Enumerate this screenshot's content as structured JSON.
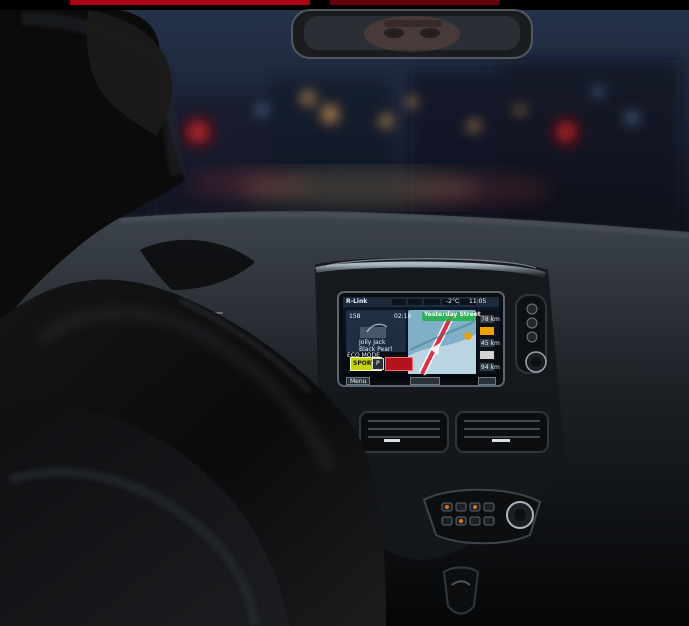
{
  "infotainment": {
    "brand": "R-Link",
    "clock": "11:05",
    "temperature": "-2°C",
    "media": {
      "song_line1": "Jolly Jack",
      "song_line2": "Black Pearl",
      "elapsed": "02:18",
      "preset": "158"
    },
    "drive_mode": {
      "label_small": "ECO MODE",
      "mode": "SPORT",
      "gear": "P"
    },
    "navigation": {
      "banner": "Yesterday Street",
      "distance_1": "78 km",
      "distance_2": "45 km",
      "distance_3": "94 km"
    },
    "softkeys": {
      "menu_label": "Menu"
    }
  }
}
